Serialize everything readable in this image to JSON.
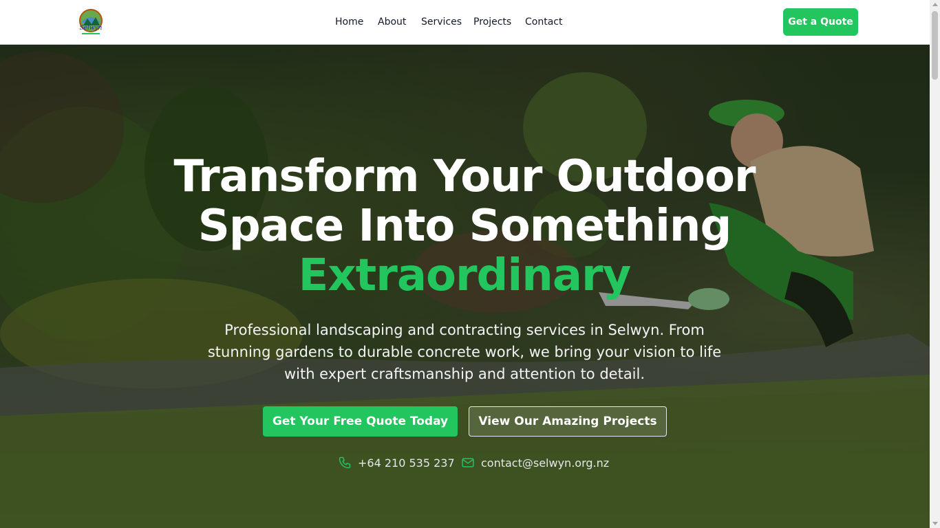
{
  "nav": {
    "logo_icon": "selwyn-logo",
    "links": [
      "Home",
      "About",
      "Services",
      "Projects",
      "Contact"
    ],
    "cta_label": "Get a Quote"
  },
  "hero": {
    "title_line1": "Transform Your Outdoor",
    "title_line2": "Space Into Something",
    "title_accent": "Extraordinary",
    "subtitle": "Professional landscaping and contracting services in Selwyn. From stunning gardens to durable concrete work, we bring your vision to life with expert craftsmanship and attention to detail.",
    "primary_button": "Get Your Free Quote Today",
    "secondary_button": "View Our Amazing Projects",
    "phone": "+64 210 535 237",
    "email": "contact@selwyn.org.nz",
    "phone_icon": "phone-icon",
    "email_icon": "mail-icon"
  },
  "colors": {
    "accent": "#22c55e",
    "header_bg": "#ffffff",
    "text_dark": "#111827"
  }
}
